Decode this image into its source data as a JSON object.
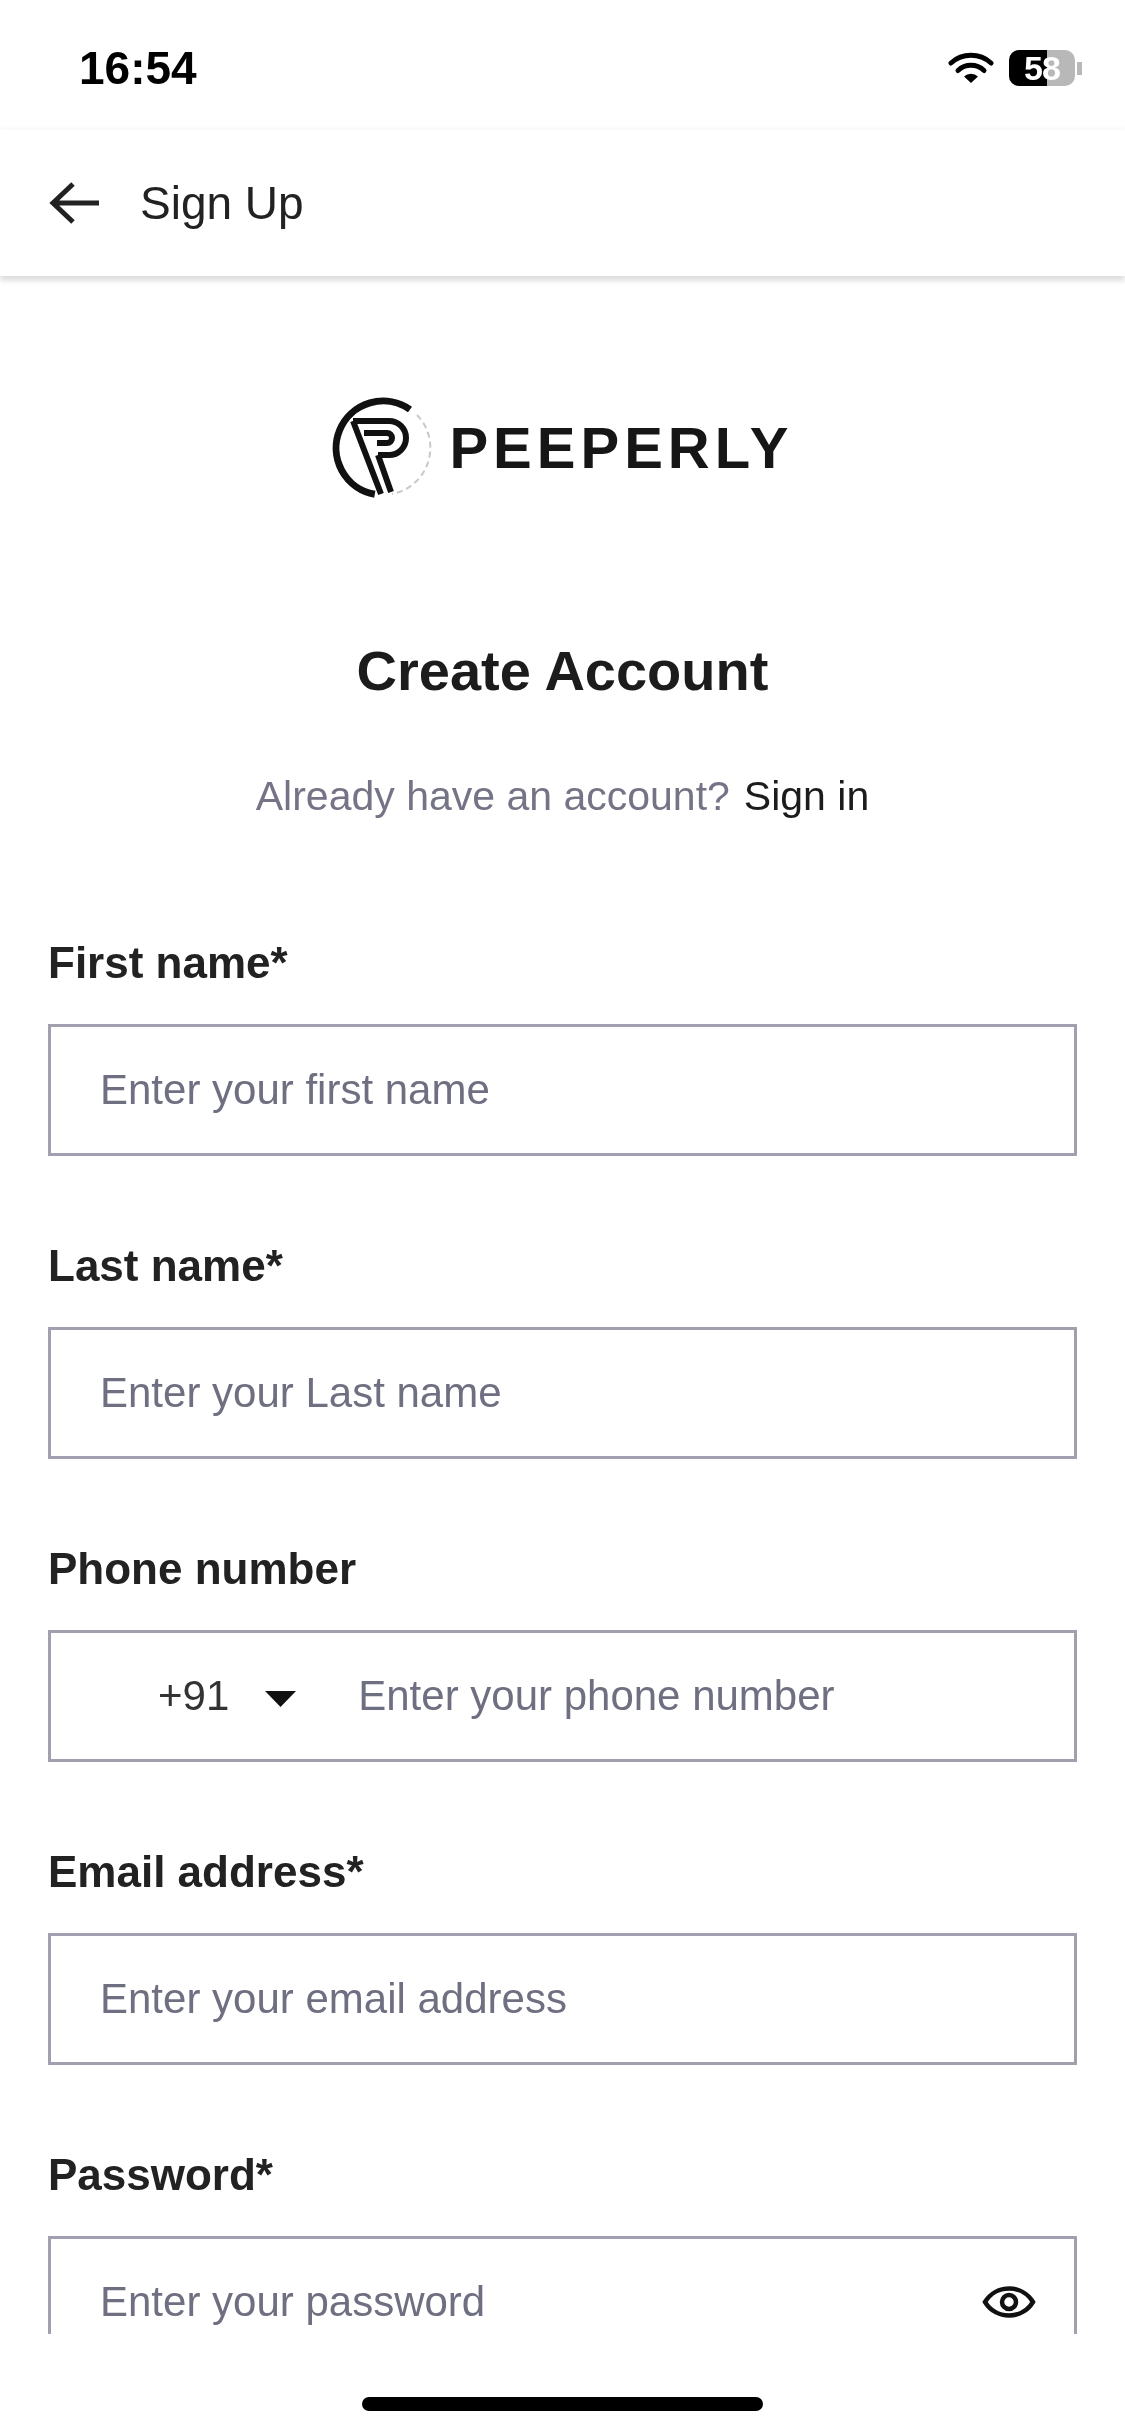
{
  "status_bar": {
    "time": "16:54",
    "battery": "58"
  },
  "header": {
    "title": "Sign Up"
  },
  "logo": {
    "text": "PEEPERLY"
  },
  "heading": "Create Account",
  "signin_prompt": {
    "text": "Already have an account?",
    "link": "Sign in"
  },
  "fields": [
    {
      "kind": "text",
      "label": "First name*",
      "placeholder": "Enter your first name"
    },
    {
      "kind": "text",
      "label": "Last name*",
      "placeholder": "Enter your Last name"
    },
    {
      "kind": "phone",
      "label": "Phone number",
      "country_code": "+91",
      "placeholder": "Enter your phone number"
    },
    {
      "kind": "text",
      "label": "Email address*",
      "placeholder": "Enter your email address"
    },
    {
      "kind": "password",
      "label": "Password*",
      "placeholder": "Enter your password"
    }
  ]
}
